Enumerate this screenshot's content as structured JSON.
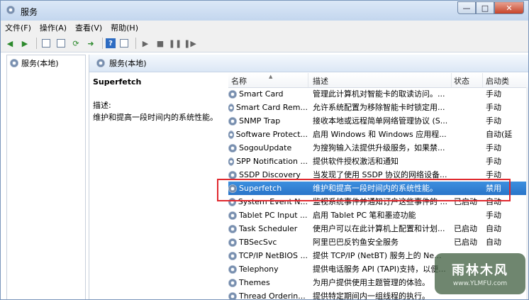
{
  "window": {
    "title": "服务",
    "min": "—",
    "max": "□",
    "close": "✕"
  },
  "menu": [
    "文件(F)",
    "操作(A)",
    "查看(V)",
    "帮助(H)"
  ],
  "toolbar": {
    "icons": [
      "back-arrow-icon",
      "forward-arrow-icon",
      "console-tree-icon",
      "properties-icon",
      "refresh-icon",
      "export-icon",
      "help-icon",
      "view-icon",
      "play-icon",
      "stop-icon",
      "pause-icon",
      "restart-icon"
    ],
    "help_glyph": "?"
  },
  "tree": {
    "root": "服务(本地)"
  },
  "right": {
    "header": "服务(本地)"
  },
  "detail": {
    "title": "Superfetch",
    "label": "描述:",
    "description": "维护和提高一段时间内的系统性能。"
  },
  "columns": {
    "name": "名称",
    "desc": "描述",
    "status": "状态",
    "start": "启动类"
  },
  "services": [
    {
      "name": "Smart Card",
      "desc": "管理此计算机对智能卡的取读访问。...",
      "status": "",
      "start": "手动"
    },
    {
      "name": "Smart Card Rem...",
      "desc": "允许系统配置为移除智能卡时锁定用...",
      "status": "",
      "start": "手动"
    },
    {
      "name": "SNMP Trap",
      "desc": "接收本地或远程简单网络管理协议 (S...",
      "status": "",
      "start": "手动"
    },
    {
      "name": "Software Protect...",
      "desc": "启用 Windows 和 Windows 应用程...",
      "status": "",
      "start": "自动(延"
    },
    {
      "name": "SogouUpdate",
      "desc": "为搜狗输入法提供升级服务，如果禁...",
      "status": "",
      "start": "手动"
    },
    {
      "name": "SPP Notification ...",
      "desc": "提供软件授权激活和通知",
      "status": "",
      "start": "手动"
    },
    {
      "name": "SSDP Discovery",
      "desc": "当发现了使用 SSDP 协议的网络设备...",
      "status": "",
      "start": "手动"
    },
    {
      "name": "Superfetch",
      "desc": "维护和提高一段时间内的系统性能。",
      "status": "",
      "start": "禁用"
    },
    {
      "name": "System Event N...",
      "desc": "监视系统事件并通知订户这些事件的 ...",
      "status": "已启动",
      "start": "自动"
    },
    {
      "name": "Tablet PC Input ...",
      "desc": "启用 Tablet PC 笔和墨迹功能",
      "status": "",
      "start": "手动"
    },
    {
      "name": "Task Scheduler",
      "desc": "使用户可以在此计算机上配置和计划...",
      "status": "已启动",
      "start": "自动"
    },
    {
      "name": "TBSecSvc",
      "desc": "阿里巴巴反钓鱼安全服务",
      "status": "已启动",
      "start": "自动"
    },
    {
      "name": "TCP/IP NetBIOS ...",
      "desc": "提供 TCP/IP (NetBT) 服务上的 Ne...",
      "status": "",
      "start": ""
    },
    {
      "name": "Telephony",
      "desc": "提供电话服务 API (TAPI)支持，以便...",
      "status": "",
      "start": ""
    },
    {
      "name": "Themes",
      "desc": "为用户提供使用主题管理的体验。",
      "status": "",
      "start": ""
    },
    {
      "name": "Thread Orderin...",
      "desc": "提供特定期间内一组线程的执行。",
      "status": "",
      "start": ""
    }
  ],
  "selected_index": 7,
  "watermark": {
    "main": "雨林木风",
    "sub": "www.YLMFU.com"
  },
  "colors": {
    "selection": "#3080d8",
    "highlight_border": "#e0292f"
  }
}
